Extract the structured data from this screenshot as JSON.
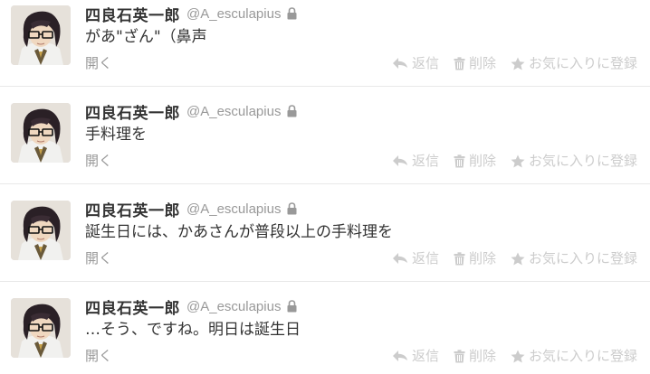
{
  "colors": {
    "name": "#333333",
    "handle": "#999999",
    "action": "#cccccc",
    "divider": "#e8e8e8"
  },
  "tweets": [
    {
      "fullname": "四良石英一郎",
      "username": "@A_esculapius",
      "text": "があ\"ざん\"（鼻声",
      "open_label": "開く",
      "reply_label": "返信",
      "delete_label": "削除",
      "favorite_label": "お気に入りに登録"
    },
    {
      "fullname": "四良石英一郎",
      "username": "@A_esculapius",
      "text": "手料理を",
      "open_label": "開く",
      "reply_label": "返信",
      "delete_label": "削除",
      "favorite_label": "お気に入りに登録"
    },
    {
      "fullname": "四良石英一郎",
      "username": "@A_esculapius",
      "text": "誕生日には、かあさんが普段以上の手料理を",
      "open_label": "開く",
      "reply_label": "返信",
      "delete_label": "削除",
      "favorite_label": "お気に入りに登録"
    },
    {
      "fullname": "四良石英一郎",
      "username": "@A_esculapius",
      "text": "…そう、ですね。明日は誕生日",
      "open_label": "開く",
      "reply_label": "返信",
      "delete_label": "削除",
      "favorite_label": "お気に入りに登録"
    }
  ],
  "icons": {
    "avatar": "avatar",
    "lock": "lock-icon",
    "reply": "reply-icon",
    "delete": "trash-icon",
    "favorite": "star-icon"
  }
}
